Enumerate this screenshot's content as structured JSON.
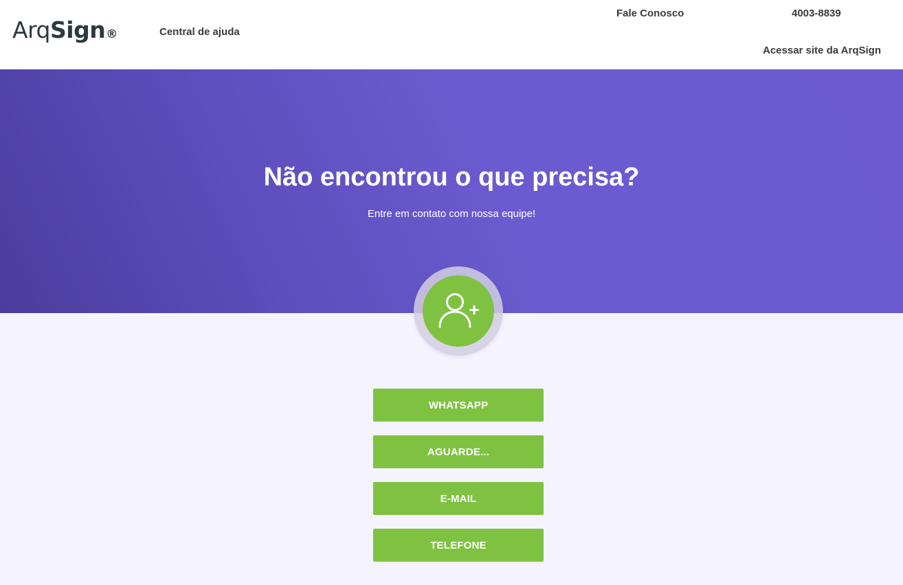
{
  "header": {
    "logo": {
      "part1": "Arq",
      "part2": "Sign",
      "mark": "®"
    },
    "help_center": "Central de ajuda",
    "contact": "Fale Conosco",
    "phone": "4003-8839",
    "site_link": "Acessar site da ArqSign"
  },
  "hero": {
    "title": "Não encontrou o que precisa?",
    "subtitle": "Entre em contato com nossa equipe!"
  },
  "contact_icon": "user-plus-icon",
  "buttons": {
    "whatsapp": "WHATSAPP",
    "chat": "AGUARDE...",
    "email": "E-MAIL",
    "phone": "TELEFONE"
  },
  "colors": {
    "accent_green": "#7fc241",
    "hero_purple": "#6b5bd0",
    "background": "#f5f3fd"
  }
}
